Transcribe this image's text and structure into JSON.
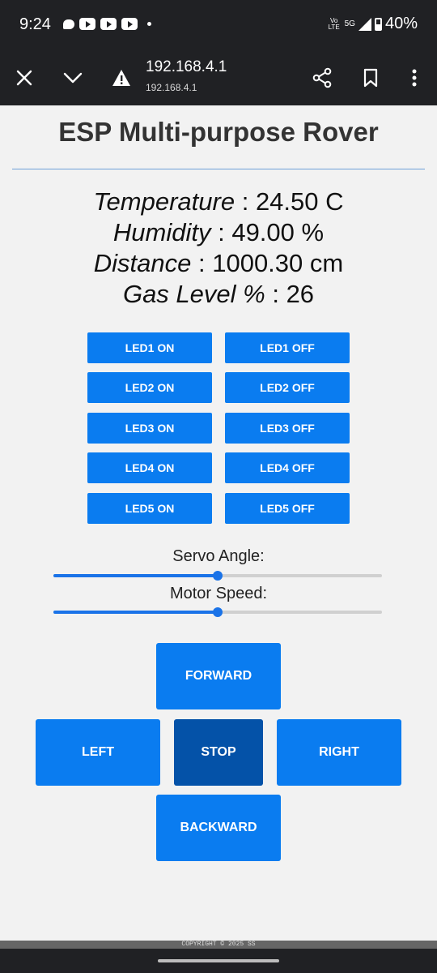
{
  "status_bar": {
    "time": "9:24",
    "network": "5G",
    "volte": "Vo LTE",
    "battery": "40%"
  },
  "browser": {
    "host": "192.168.4.1",
    "url": "192.168.4.1"
  },
  "page": {
    "title": "ESP Multi-purpose Rover",
    "readings": [
      {
        "label": "Temperature",
        "value": "24.50 C"
      },
      {
        "label": "Humidity",
        "value": "49.00 %"
      },
      {
        "label": "Distance",
        "value": "1000.30 cm"
      },
      {
        "label": "Gas Level %",
        "value": "26"
      }
    ],
    "leds": [
      {
        "on": "LED1 ON",
        "off": "LED1 OFF"
      },
      {
        "on": "LED2 ON",
        "off": "LED2 OFF"
      },
      {
        "on": "LED3 ON",
        "off": "LED3 OFF"
      },
      {
        "on": "LED4 ON",
        "off": "LED4 OFF"
      },
      {
        "on": "LED5 ON",
        "off": "LED5 OFF"
      }
    ],
    "servo": {
      "label": "Servo Angle:",
      "value_fraction": 0.5
    },
    "motor": {
      "label": "Motor Speed:",
      "value_fraction": 0.5
    },
    "controls": {
      "forward": "FORWARD",
      "left": "LEFT",
      "stop": "STOP",
      "right": "RIGHT",
      "backward": "BACKWARD"
    },
    "footer": "COPYRIGHT © 2025 SS"
  },
  "colors": {
    "button": "#0a7cf0",
    "stop_button": "#0452a8",
    "slider": "#1a73e8"
  }
}
